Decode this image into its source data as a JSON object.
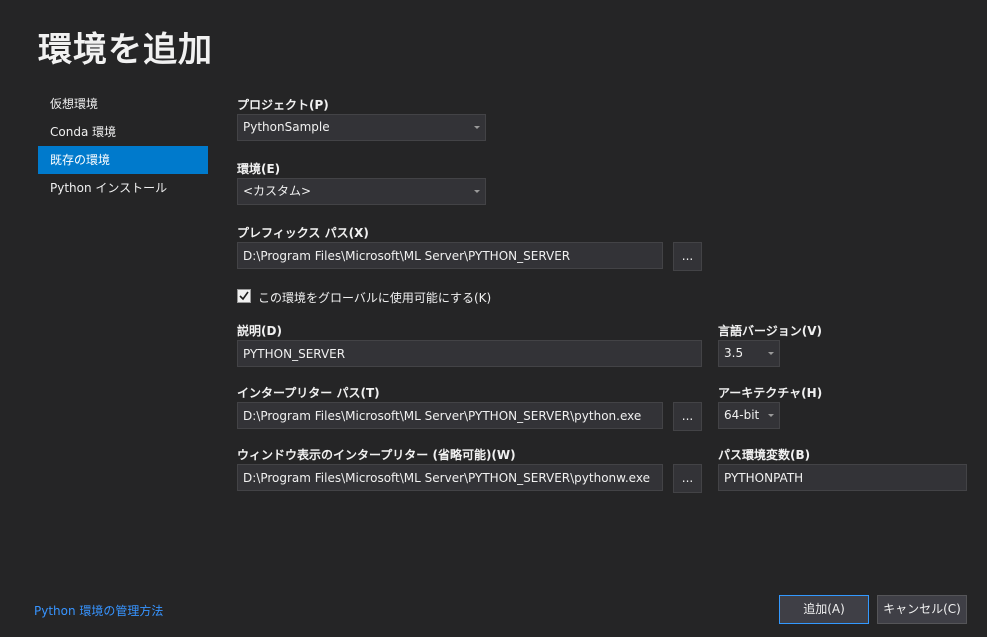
{
  "title": "環境を追加",
  "nav": {
    "items": [
      "仮想環境",
      "Conda 環境",
      "既存の環境",
      "Python インストール"
    ],
    "selected": 2
  },
  "form": {
    "project_label": "プロジェクト(P)",
    "project_value": "PythonSample",
    "env_label": "環境(E)",
    "env_value": "<カスタム>",
    "prefix_label": "プレフィックス パス(X)",
    "prefix_value": "D:\\Program Files\\Microsoft\\ML Server\\PYTHON_SERVER",
    "browse_label": "...",
    "global_check_label": "この環境をグローバルに使用可能にする(K)",
    "global_checked": true,
    "desc_label": "説明(D)",
    "desc_value": "PYTHON_SERVER",
    "lang_label": "言語バージョン(V)",
    "lang_value": "3.5",
    "interp_label": "インタープリター パス(T)",
    "interp_value": "D:\\Program Files\\Microsoft\\ML Server\\PYTHON_SERVER\\python.exe",
    "arch_label": "アーキテクチャ(H)",
    "arch_value": "64-bit",
    "winterp_label": "ウィンドウ表示のインタープリター (省略可能)(W)",
    "winterp_value": "D:\\Program Files\\Microsoft\\ML Server\\PYTHON_SERVER\\pythonw.exe",
    "pathvar_label": "パス環境変数(B)",
    "pathvar_value": "PYTHONPATH"
  },
  "footer": {
    "help_link": "Python 環境の管理方法",
    "add_button": "追加(A)",
    "cancel_button": "キャンセル(C)"
  },
  "colors": {
    "background": "#252526",
    "accent": "#007acc",
    "link": "#3794ff"
  }
}
